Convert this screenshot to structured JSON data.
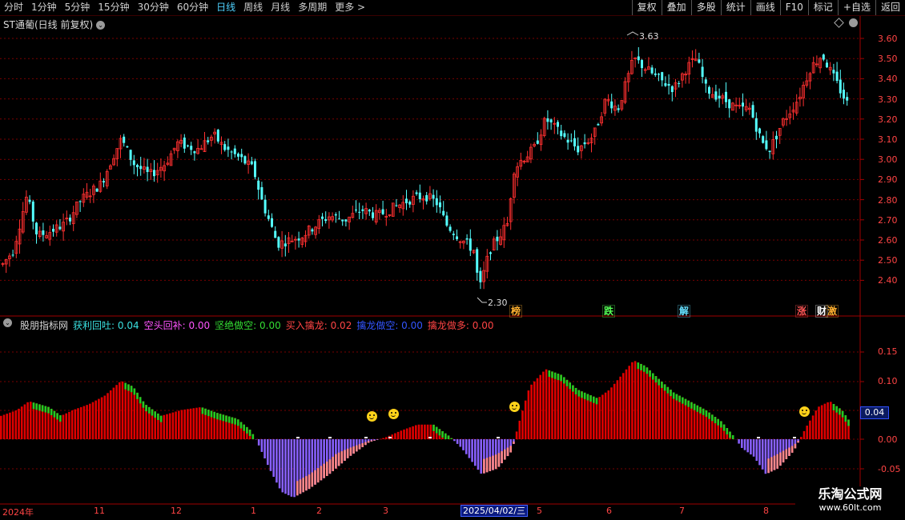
{
  "toolbar": {
    "periods": [
      "分时",
      "1分钟",
      "5分钟",
      "15分钟",
      "30分钟",
      "60分钟",
      "日线",
      "周线",
      "月线",
      "多周期",
      "更多 >"
    ],
    "active_period": "日线",
    "buttons": [
      "复权",
      "叠加",
      "多股",
      "统计",
      "画线",
      "F10",
      "标记",
      "+自选",
      "返回"
    ]
  },
  "stock": {
    "title": "ST通葡(日线 前复权)",
    "high_label": "3.63",
    "low_label": "2.30",
    "price_ticks": [
      "3.60",
      "3.50",
      "3.40",
      "3.30",
      "3.20",
      "3.10",
      "3.00",
      "2.90",
      "2.80",
      "2.70",
      "2.60",
      "2.50",
      "2.40"
    ]
  },
  "events": [
    {
      "text": "榜",
      "color": "#ffb030"
    },
    {
      "text": "跌",
      "color": "#55ff55"
    },
    {
      "text": "解",
      "color": "#66e0ff"
    },
    {
      "text": "涨",
      "color": "#ff5555"
    },
    {
      "text": "财",
      "color": "#ffffff"
    },
    {
      "text": "激",
      "color": "#ffb030"
    }
  ],
  "indicator": {
    "name": "股朋指标网",
    "items": [
      {
        "text": "获利回吐: 0.04",
        "color": "#3ae0e0"
      },
      {
        "text": "空头回补: 0.00",
        "color": "#ff55ff"
      },
      {
        "text": "坚绝做空: 0.00",
        "color": "#33dd33"
      },
      {
        "text": "买入擒龙: 0.02",
        "color": "#ff4444"
      },
      {
        "text": "擒龙做空: 0.00",
        "color": "#3355ff"
      },
      {
        "text": "擒龙做多: 0.00",
        "color": "#ff4444"
      }
    ],
    "ticks": [
      "0.15",
      "0.10",
      "0.05",
      "0.00",
      "-0.05"
    ],
    "current_value": "0.04"
  },
  "dates": [
    "2024年",
    "11",
    "12",
    "1",
    "2",
    "3",
    "4",
    "5",
    "6",
    "7",
    "8"
  ],
  "cursor_date": "2025/04/02/三",
  "watermark": {
    "name": "乐淘公式网",
    "url": "www.60lt.com"
  },
  "colors": {
    "up": "#ff3030",
    "down": "#54ffff",
    "grid": "#7a0000",
    "bar_red": "#e00000",
    "bar_green": "#22cc22",
    "bar_purple": "#8860ff",
    "bar_pink": "#ff8888"
  }
}
